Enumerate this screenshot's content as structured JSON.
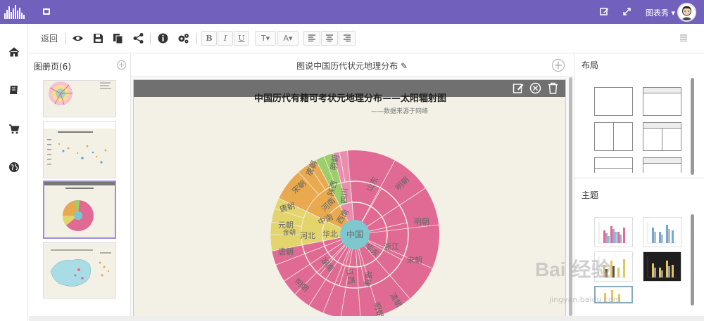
{
  "topbar": {
    "user_name": "图表秀 ▾",
    "icons": [
      "logo-icon",
      "menu-toggle-icon",
      "edit-icon",
      "fullscreen-icon",
      "avatar"
    ]
  },
  "leftnav": {
    "items": [
      "home-icon",
      "book-icon",
      "cart-icon",
      "globe-icon"
    ]
  },
  "toolbar": {
    "back_label": "返回",
    "text_buttons": [
      "B",
      "I",
      "U",
      "T▾",
      "A▾"
    ]
  },
  "pages": {
    "title": "图册页(6)"
  },
  "canvas": {
    "title": "图说中国历代状元地理分布 ✎"
  },
  "chart": {
    "title": "中国历代有籍可考状元地理分布——太阳辐射图",
    "subtitle": "——数据来源于网络",
    "center_label": "中国",
    "inner_labels": [
      "华东",
      "华北",
      "西南",
      "中南"
    ],
    "province_labels": [
      "浙江",
      "山东",
      "广东",
      "河北",
      "河南",
      "陕西",
      "四川",
      "江西",
      "湖南",
      "福建"
    ],
    "outer_labels": [
      "明朝",
      "宋朝",
      "清朝",
      "唐朝",
      "元朝",
      "金朝"
    ],
    "colors": {
      "center": "#7ec7cf",
      "pink": "#e06a93",
      "orange": "#e8a94f",
      "yellow": "#e3d46b",
      "green": "#9ccf6b",
      "lightpink": "#ec8db0"
    }
  },
  "rpanel": {
    "layout_title": "布局",
    "theme_title": "主题"
  },
  "watermark": {
    "text": "Bai 经验",
    "sub": "jingyan.baidu.com"
  }
}
